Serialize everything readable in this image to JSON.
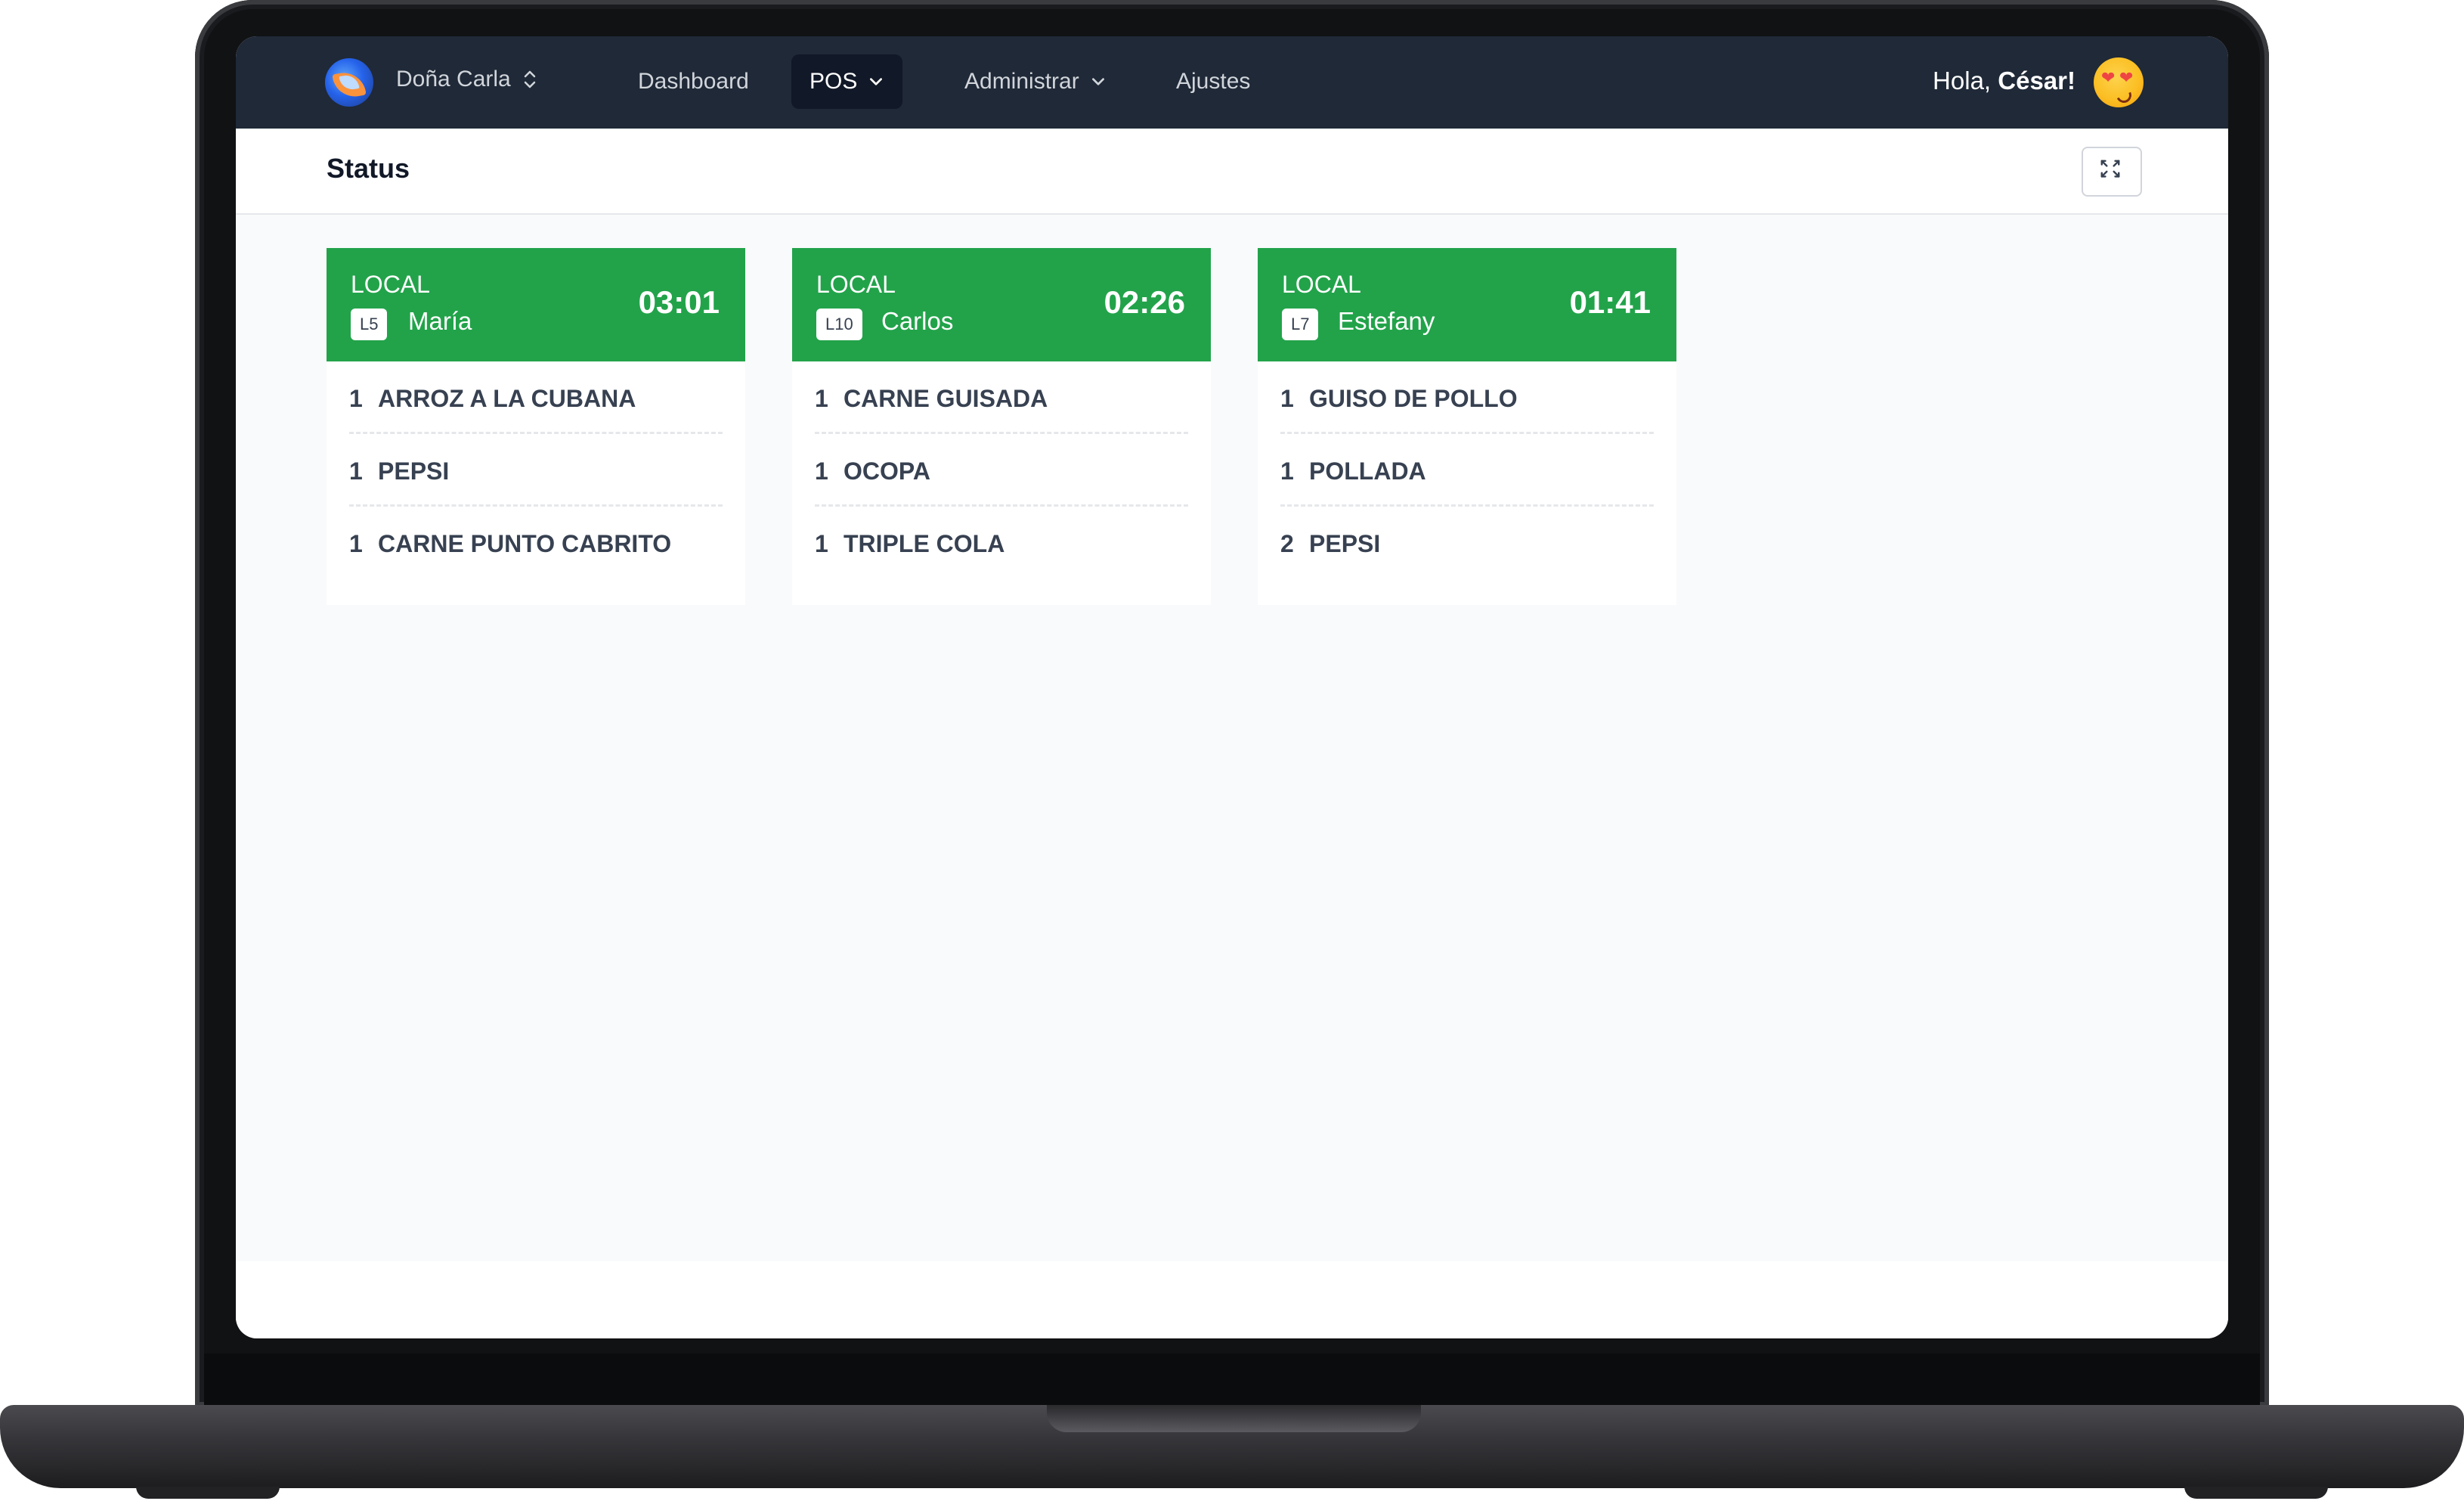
{
  "navbar": {
    "brand": "Doña Carla",
    "items": [
      {
        "label": "Dashboard"
      },
      {
        "label": "POS"
      },
      {
        "label": "Administrar"
      },
      {
        "label": "Ajustes"
      }
    ],
    "greeting_prefix": "Hola,",
    "user_name": "César!"
  },
  "page": {
    "title": "Status"
  },
  "orders": [
    {
      "type": "LOCAL",
      "table": "L5",
      "waiter": "María",
      "timer": "03:01",
      "items": [
        {
          "qty": "1",
          "name": "ARROZ A LA CUBANA"
        },
        {
          "qty": "1",
          "name": "PEPSI"
        },
        {
          "qty": "1",
          "name": "CARNE PUNTO CABRITO"
        }
      ]
    },
    {
      "type": "LOCAL",
      "table": "L10",
      "waiter": "Carlos",
      "timer": "02:26",
      "items": [
        {
          "qty": "1",
          "name": "CARNE GUISADA"
        },
        {
          "qty": "1",
          "name": "OCOPA"
        },
        {
          "qty": "1",
          "name": "TRIPLE COLA"
        }
      ]
    },
    {
      "type": "LOCAL",
      "table": "L7",
      "waiter": "Estefany",
      "timer": "01:41",
      "items": [
        {
          "qty": "1",
          "name": "GUISO DE POLLO"
        },
        {
          "qty": "1",
          "name": "POLLADA"
        },
        {
          "qty": "2",
          "name": "PEPSI"
        }
      ]
    }
  ],
  "colors": {
    "navbar_bg": "#1f2937",
    "order_header_green": "#22a34a",
    "content_bg": "#f9fafb"
  }
}
